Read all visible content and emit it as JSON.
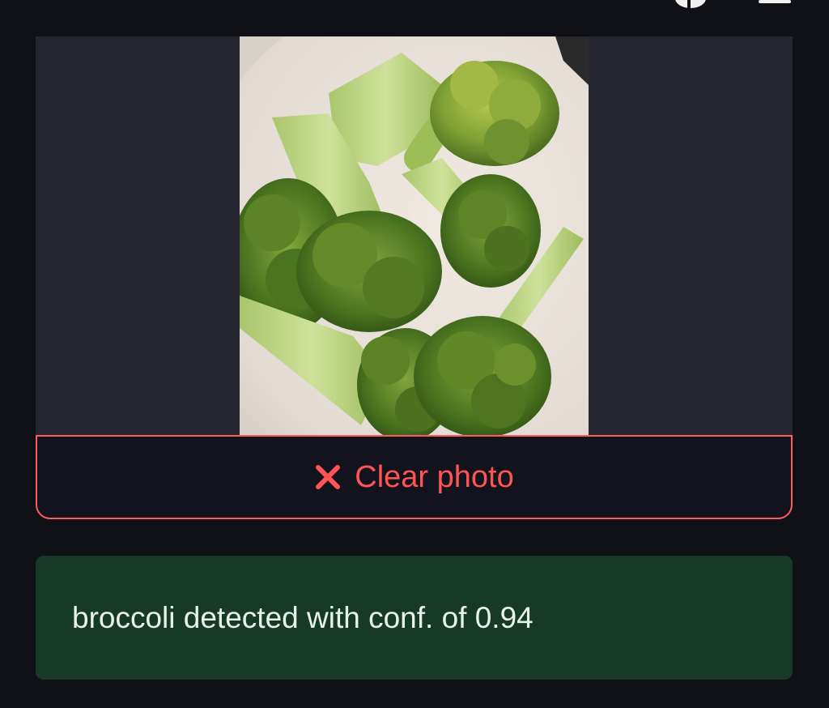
{
  "header": {
    "icons": [
      "github-icon",
      "menu-icon"
    ]
  },
  "image_panel": {
    "photo_subject": "broccoli-photo"
  },
  "clear_button": {
    "icon": "close-icon",
    "label": "Clear photo"
  },
  "result": {
    "text": "broccoli detected with conf. of 0.94"
  },
  "colors": {
    "background": "#0f1117",
    "panel": "#262631",
    "button_accent": "#ff5454",
    "result_bg": "#173928",
    "result_text": "#e8f3e8"
  }
}
